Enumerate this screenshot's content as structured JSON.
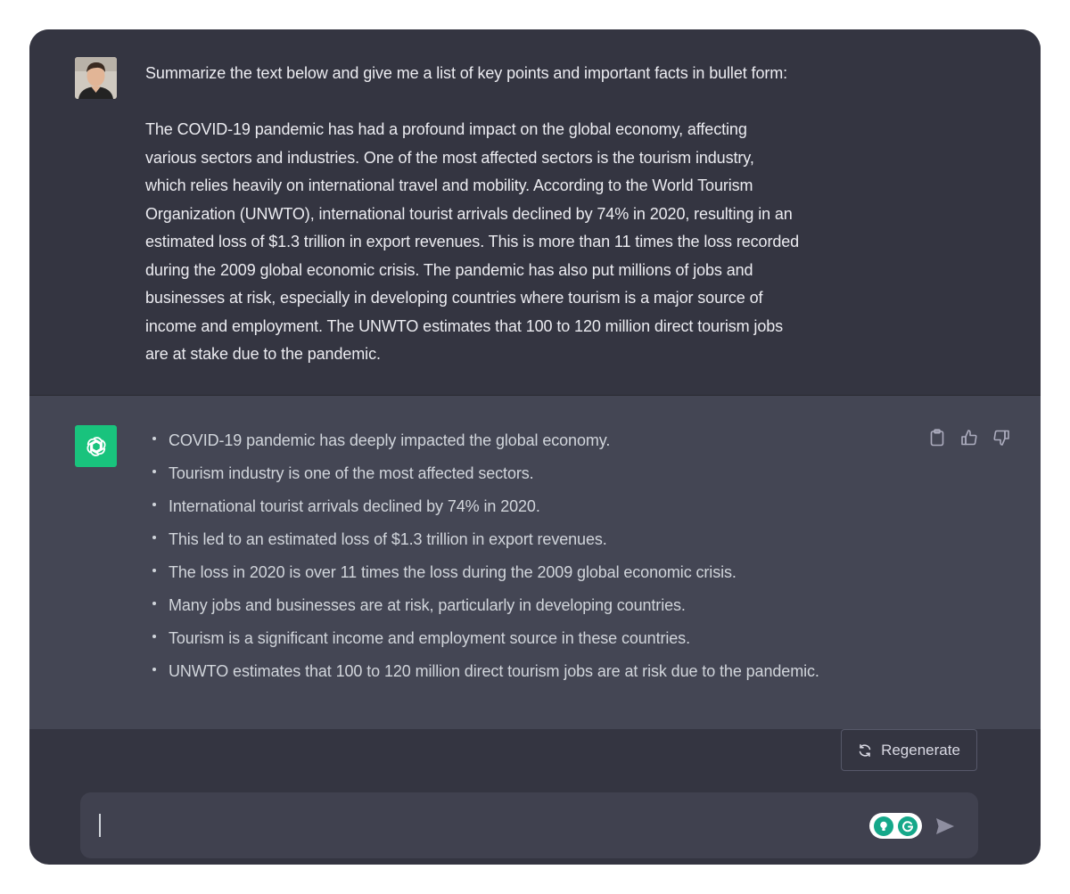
{
  "user_message": {
    "prompt_line": "Summarize the text below and give me a list of key points and important facts in bullet form:",
    "passage_lines": [
      "The COVID-19 pandemic has had a profound impact on the global economy, affecting",
      "various sectors and industries. One of the most affected sectors is the tourism industry,",
      "which relies heavily on international travel and mobility. According to the World Tourism",
      "Organization (UNWTO), international tourist arrivals declined by 74% in 2020, resulting in an",
      "estimated loss of $1.3 trillion in export revenues. This is more than 11 times the loss recorded",
      "during the 2009 global economic crisis. The pandemic has also put millions of jobs and",
      "businesses at risk, especially in developing countries where tourism is a major source of",
      "income and employment. The UNWTO estimates that 100 to 120 million direct tourism jobs",
      "are at stake due to the pandemic."
    ]
  },
  "assistant_message": {
    "bullets": [
      "COVID-19 pandemic has deeply impacted the global economy.",
      "Tourism industry is one of the most affected sectors.",
      "International tourist arrivals declined by 74% in 2020.",
      "This led to an estimated loss of $1.3 trillion in export revenues.",
      "The loss in 2020 is over 11 times the loss during the 2009 global economic crisis.",
      "Many jobs and businesses are at risk, particularly in developing countries.",
      "Tourism is a significant income and employment source in these countries.",
      "UNWTO estimates that 100 to 120 million direct tourism jobs are at risk due to the pandemic."
    ],
    "icons": [
      "clipboard-icon",
      "thumbs-up-icon",
      "thumbs-down-icon"
    ]
  },
  "regenerate_label": "Regenerate",
  "composer": {
    "value": "",
    "icons": [
      "grammarly-bulb-icon",
      "grammarly-g-icon",
      "send-icon"
    ]
  },
  "colors": {
    "bg_user": "#343541",
    "bg_assistant": "#444654",
    "composer_bg": "#40414f",
    "gpt_green": "#19c37d",
    "grammarly_teal": "#15a88a"
  }
}
